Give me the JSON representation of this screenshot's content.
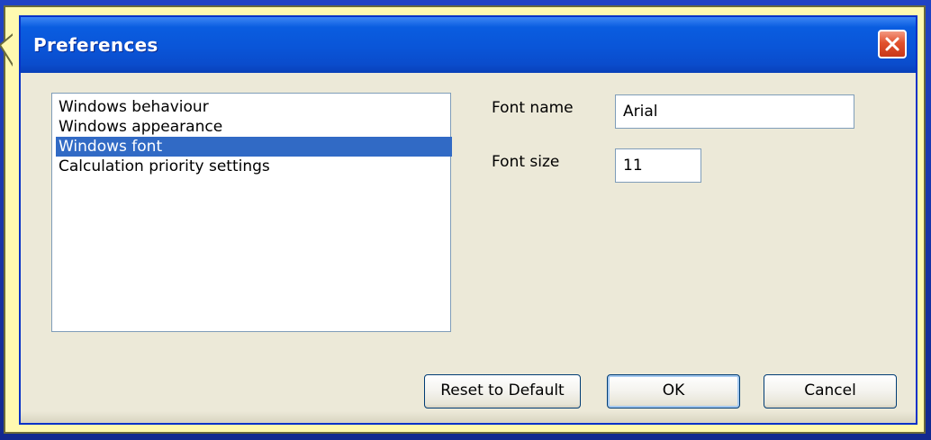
{
  "dialog": {
    "title": "Preferences",
    "close_icon": "close-icon"
  },
  "categories": [
    {
      "label": "Windows behaviour",
      "selected": false
    },
    {
      "label": "Windows appearance",
      "selected": false
    },
    {
      "label": "Windows font",
      "selected": true
    },
    {
      "label": "Calculation priority settings",
      "selected": false
    }
  ],
  "settings": {
    "font_name_label": "Font name",
    "font_name_value": "Arial",
    "font_size_label": "Font size",
    "font_size_value": "11"
  },
  "buttons": {
    "reset_label": "Reset to Default",
    "ok_label": "OK",
    "cancel_label": "Cancel"
  },
  "colors": {
    "titlebar": "#0a55d8",
    "selection": "#316ac5",
    "callout": "#fff9b0",
    "backdrop": "#1632a6"
  }
}
